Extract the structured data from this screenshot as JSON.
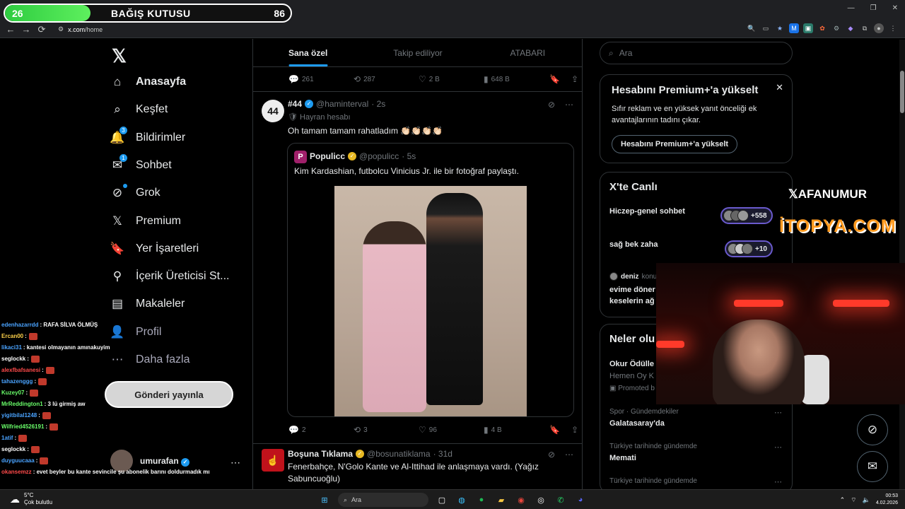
{
  "donation": {
    "current": "26",
    "title": "BAĞIŞ KUTUSU",
    "target": "86",
    "progress": 0.3
  },
  "browser": {
    "url_host": "x.com",
    "url_path": "/home"
  },
  "nav": {
    "items": [
      {
        "label": "Anasayfa",
        "icon": "home-icon"
      },
      {
        "label": "Keşfet",
        "icon": "search-icon"
      },
      {
        "label": "Bildirimler",
        "icon": "bell-icon",
        "badge": "3"
      },
      {
        "label": "Sohbet",
        "icon": "mail-icon",
        "badge": "1"
      },
      {
        "label": "Grok",
        "icon": "grok-icon"
      },
      {
        "label": "Premium",
        "icon": "x-icon"
      },
      {
        "label": "Yer İşaretleri",
        "icon": "bookmark-icon"
      },
      {
        "label": "İçerik Üreticisi St...",
        "icon": "creator-icon"
      },
      {
        "label": "Makaleler",
        "icon": "article-icon"
      },
      {
        "label": "Profil",
        "icon": "profile-icon"
      },
      {
        "label": "Daha fazla",
        "icon": "more-icon"
      }
    ],
    "post_button": "Gönderi yayınla",
    "account_name": "umurafan"
  },
  "chat": [
    {
      "user": "edenhazarrdd",
      "color": "#4aa3ff",
      "msg": ": RAFA SİLVA ÖLMÜŞ"
    },
    {
      "user": "Ercan00",
      "color": "#ffd24a",
      "msg": ":"
    },
    {
      "user": "likaci31",
      "color": "#4aa3ff",
      "msg": ": kantesi olmayanın amınakuyim"
    },
    {
      "user": "seglockk",
      "color": "#ffffff",
      "msg": ":"
    },
    {
      "user": "alexfbafsanesi",
      "color": "#ff4a4a",
      "msg": ":"
    },
    {
      "user": "tahazenggg",
      "color": "#4aa3ff",
      "msg": ":"
    },
    {
      "user": "Kuzey07",
      "color": "#6aff6a",
      "msg": ":"
    },
    {
      "user": "MrReddington1",
      "color": "#6aff6a",
      "msg": ": 3 lü girmiş aw"
    },
    {
      "user": "yigitbilal1248",
      "color": "#4aa3ff",
      "msg": ":"
    },
    {
      "user": "Wilfried4526191",
      "color": "#6aff6a",
      "msg": ":"
    },
    {
      "user": "1atif",
      "color": "#4aa3ff",
      "msg": ":"
    },
    {
      "user": "seglockk",
      "color": "#ffffff",
      "msg": ":"
    },
    {
      "user": "duyguucaaa",
      "color": "#4aa3ff",
      "msg": ":"
    },
    {
      "user": "okansemzz",
      "color": "#ff4a4a",
      "msg": ": evet beyler bu kante sevincile şu abonelik barını doldurmadık mı"
    }
  ],
  "tabs": [
    "Sana özel",
    "Takip ediliyor",
    "ATABARI"
  ],
  "post_prev_actions": {
    "replies": "261",
    "reposts": "287",
    "likes": "2 B",
    "views": "648 B"
  },
  "post": {
    "name": "#44",
    "handle": "@haminterval",
    "time": "· 2s",
    "label": "Hayran hesabı",
    "text": "Oh tamam tamam rahatladım 👏🏻👏🏻👏🏻👏🏻",
    "quote": {
      "name": "Populicc",
      "handle": "@populicc",
      "time": "· 5s",
      "text": "Kim Kardashian, futbolcu Vinicius Jr. ile bir fotoğraf paylaştı."
    },
    "actions": {
      "replies": "2",
      "reposts": "3",
      "likes": "96",
      "views": "4 B"
    }
  },
  "post2": {
    "name": "Boşuna Tıklama",
    "handle": "@bosunatiklama",
    "time": "· 31d",
    "text": "Fenerbahçe, N'Golo Kante ve Al-Ittihad ile anlaşmaya vardı. (Yağız Sabuncuoğlu)"
  },
  "right": {
    "search_placeholder": "Ara",
    "premium": {
      "title": "Hesabını Premium+'a yükselt",
      "desc": "Sıfır reklam ve en yüksek yanıt önceliği ek avantajlarının tadını çıkar.",
      "button": "Hesabını Premium+'a yükselt"
    },
    "live": {
      "title": "X'te Canlı",
      "rows": [
        {
          "name": "Hiczep-genel sohbet",
          "count": "+558"
        },
        {
          "name": "sağ bek zaha",
          "count": "+10"
        }
      ],
      "third_user": "deniz",
      "third_meta": "konu",
      "third_text1": "evime döner",
      "third_text2": "keselerin ağ"
    },
    "trends": {
      "title": "Neler olu",
      "t1_name": "Okur Ödülle",
      "t1_sub": "Hemen Oy K",
      "t1_promo": "Promoted b",
      "items": [
        {
          "meta": "Spor · Gündemdekiler",
          "name": "Galatasaray'da"
        },
        {
          "meta": "Türkiye tarihinde gündemde",
          "name": "Memati"
        },
        {
          "meta": "Türkiye tarihinde gündemde",
          "name": ""
        }
      ]
    }
  },
  "overlay": {
    "brand1": "AFANUMUR",
    "brand2": "İTOPYA.COM"
  },
  "taskbar": {
    "temp": "5°C",
    "weather": "Çok bulutlu",
    "search": "Ara",
    "time": "00:53",
    "date": "4.02.2026"
  }
}
